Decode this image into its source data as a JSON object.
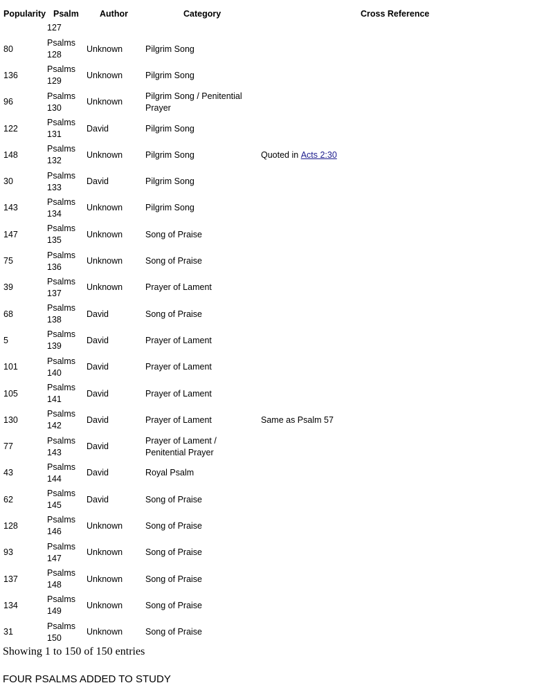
{
  "table": {
    "headers": {
      "popularity": "Popularity",
      "psalm": "Psalm",
      "author": "Author",
      "category": "Category",
      "cross_reference": "Cross Reference"
    },
    "partial_top_cell": "127",
    "rows": [
      {
        "popularity": "80",
        "psalm": "Psalms 128",
        "author": "Unknown",
        "category": "Pilgrim Song",
        "xref_text": "",
        "xref_link": ""
      },
      {
        "popularity": "136",
        "psalm": "Psalms 129",
        "author": "Unknown",
        "category": "Pilgrim Song",
        "xref_text": "",
        "xref_link": ""
      },
      {
        "popularity": "96",
        "psalm": "Psalms 130",
        "author": "Unknown",
        "category": "Pilgrim Song / Penitential Prayer",
        "xref_text": "",
        "xref_link": ""
      },
      {
        "popularity": "122",
        "psalm": "Psalms 131",
        "author": "David",
        "category": "Pilgrim Song",
        "xref_text": "",
        "xref_link": ""
      },
      {
        "popularity": "148",
        "psalm": "Psalms 132",
        "author": "Unknown",
        "category": "Pilgrim Song",
        "xref_text": "Quoted in ",
        "xref_link": "Acts 2:30"
      },
      {
        "popularity": "30",
        "psalm": "Psalms 133",
        "author": "David",
        "category": "Pilgrim Song",
        "xref_text": "",
        "xref_link": ""
      },
      {
        "popularity": "143",
        "psalm": "Psalms 134",
        "author": "Unknown",
        "category": "Pilgrim Song",
        "xref_text": "",
        "xref_link": ""
      },
      {
        "popularity": "147",
        "psalm": "Psalms 135",
        "author": "Unknown",
        "category": "Song of Praise",
        "xref_text": "",
        "xref_link": ""
      },
      {
        "popularity": "75",
        "psalm": "Psalms 136",
        "author": "Unknown",
        "category": "Song of Praise",
        "xref_text": "",
        "xref_link": ""
      },
      {
        "popularity": "39",
        "psalm": "Psalms 137",
        "author": "Unknown",
        "category": "Prayer of Lament",
        "xref_text": "",
        "xref_link": ""
      },
      {
        "popularity": "68",
        "psalm": "Psalms 138",
        "author": "David",
        "category": "Song of Praise",
        "xref_text": "",
        "xref_link": ""
      },
      {
        "popularity": "5",
        "psalm": "Psalms 139",
        "author": "David",
        "category": "Prayer of Lament",
        "xref_text": "",
        "xref_link": ""
      },
      {
        "popularity": "101",
        "psalm": "Psalms 140",
        "author": "David",
        "category": "Prayer of Lament",
        "xref_text": "",
        "xref_link": ""
      },
      {
        "popularity": "105",
        "psalm": "Psalms 141",
        "author": "David",
        "category": "Prayer of Lament",
        "xref_text": "",
        "xref_link": ""
      },
      {
        "popularity": "130",
        "psalm": "Psalms 142",
        "author": "David",
        "category": "Prayer of Lament",
        "xref_text": "Same as Psalm 57",
        "xref_link": ""
      },
      {
        "popularity": "77",
        "psalm": "Psalms 143",
        "author": "David",
        "category": "Prayer of Lament / Penitential Prayer",
        "xref_text": "",
        "xref_link": ""
      },
      {
        "popularity": "43",
        "psalm": "Psalms 144",
        "author": "David",
        "category": "Royal Psalm",
        "xref_text": "",
        "xref_link": ""
      },
      {
        "popularity": "62",
        "psalm": "Psalms 145",
        "author": "David",
        "category": "Song of Praise",
        "xref_text": "",
        "xref_link": ""
      },
      {
        "popularity": "128",
        "psalm": "Psalms 146",
        "author": "Unknown",
        "category": "Song of Praise",
        "xref_text": "",
        "xref_link": ""
      },
      {
        "popularity": "93",
        "psalm": "Psalms 147",
        "author": "Unknown",
        "category": "Song of Praise",
        "xref_text": "",
        "xref_link": ""
      },
      {
        "popularity": "137",
        "psalm": "Psalms 148",
        "author": "Unknown",
        "category": "Song of Praise",
        "xref_text": "",
        "xref_link": ""
      },
      {
        "popularity": "134",
        "psalm": "Psalms 149",
        "author": "Unknown",
        "category": "Song of Praise",
        "xref_text": "",
        "xref_link": ""
      },
      {
        "popularity": "31",
        "psalm": "Psalms 150",
        "author": "Unknown",
        "category": "Song of Praise",
        "xref_text": "",
        "xref_link": ""
      }
    ]
  },
  "footer": {
    "info": "Showing 1 to 150 of 150 entries",
    "note": "FOUR PSALMS ADDED TO STUDY"
  },
  "colors": {
    "link": "#1a1a8c"
  }
}
